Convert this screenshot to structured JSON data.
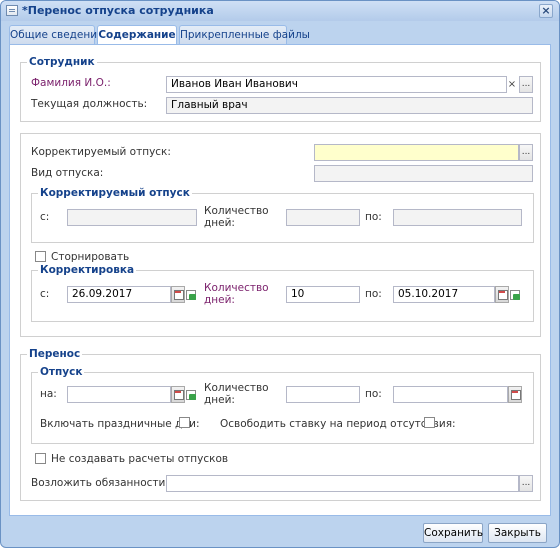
{
  "window": {
    "title": "*Перенос отпуска сотрудника",
    "close_label": "×"
  },
  "tabs": [
    "Общие сведения",
    "Содержание",
    "Прикрепленные файлы"
  ],
  "employee": {
    "group_title": "Сотрудник",
    "fio_label": "Фамилия И.О.:",
    "fio_value": "Иванов Иван Иванович",
    "position_label": "Текущая должность:",
    "position_value": "Главный врач"
  },
  "vacation": {
    "corrected_label": "Корректируемый отпуск:",
    "type_label": "Вид отпуска:",
    "corrected_group": {
      "title": "Корректируемый отпуск",
      "from_label": "с:",
      "days_label_1": "Количество",
      "days_label_2": "дней:",
      "to_label": "по:"
    },
    "reverse_label": "Сторнировать",
    "correction_group": {
      "title": "Корректировка",
      "from_label": "с:",
      "from_value": "26.09.2017",
      "days_label_1": "Количество",
      "days_label_2": "дней:",
      "days_value": "10",
      "to_label": "по:",
      "to_value": "05.10.2017"
    }
  },
  "transfer": {
    "group_title": "Перенос",
    "vacation_group": {
      "title": "Отпуск",
      "on_label": "на:",
      "days_label_1": "Количество",
      "days_label_2": "дней:",
      "to_label": "по:",
      "holidays_label": "Включать праздничные дни:",
      "free_rate_label": "Освободить ставку на период отсутствия:"
    },
    "no_calc_label": "Не создавать расчеты отпусков",
    "duties_label": "Возложить обязанности на:"
  },
  "buttons": {
    "save": "Сохранить",
    "close": "Закрыть",
    "ellipsis": "...",
    "clear": "×"
  }
}
